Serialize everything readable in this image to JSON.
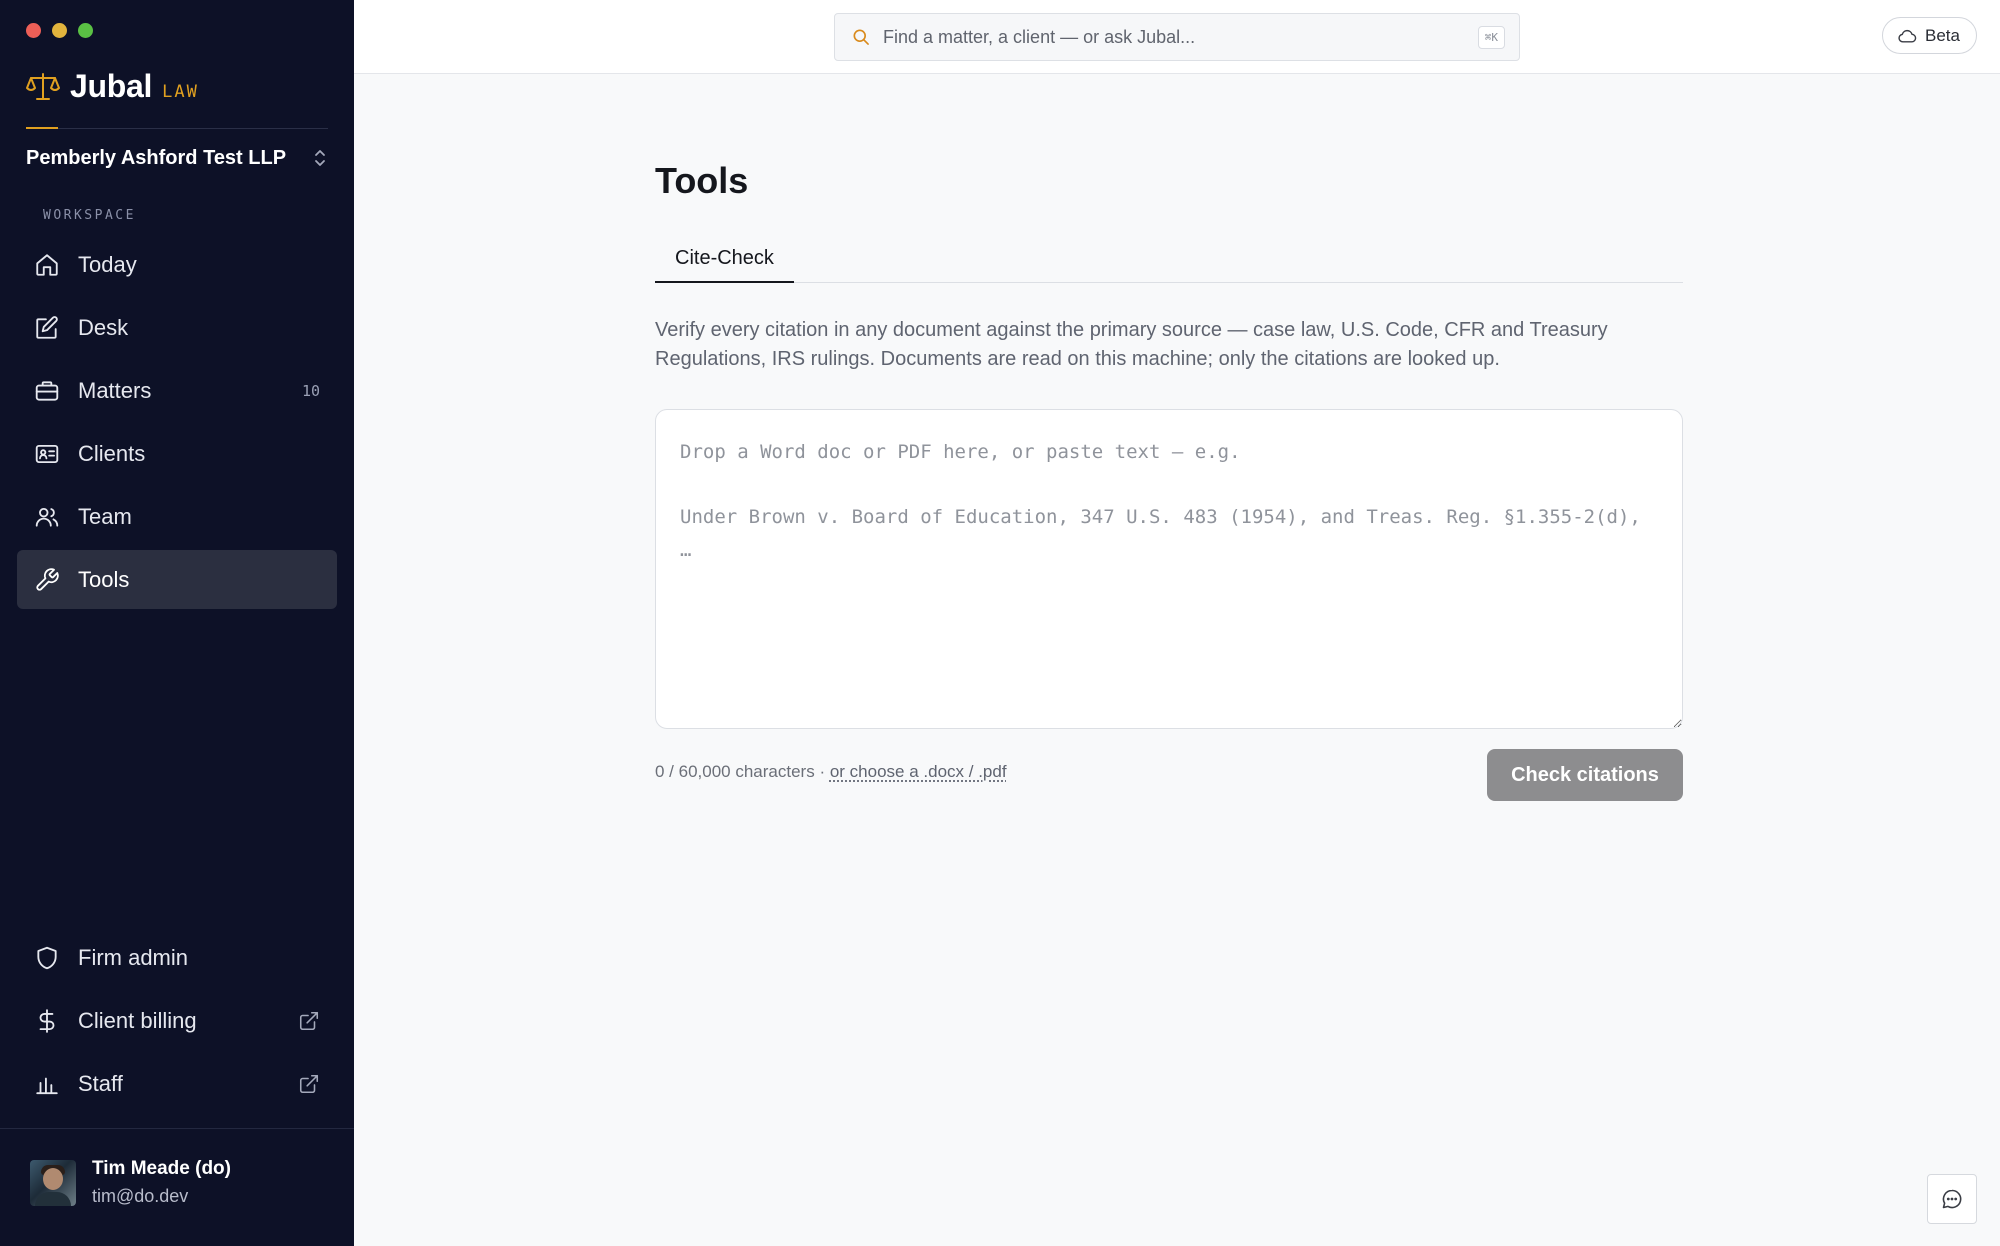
{
  "brand": {
    "name": "Jubal",
    "tag": "LAW",
    "accent": "#e0a020"
  },
  "firm": {
    "name": "Pemberly Ashford Test LLP"
  },
  "sidebar": {
    "section_label": "WORKSPACE",
    "items": [
      {
        "label": "Today",
        "icon": "home-icon"
      },
      {
        "label": "Desk",
        "icon": "edit-icon"
      },
      {
        "label": "Matters",
        "icon": "briefcase-icon",
        "count": "10"
      },
      {
        "label": "Clients",
        "icon": "id-card-icon"
      },
      {
        "label": "Team",
        "icon": "users-icon"
      },
      {
        "label": "Tools",
        "icon": "wrench-icon",
        "active": true
      }
    ],
    "bottom_items": [
      {
        "label": "Firm admin",
        "icon": "shield-icon"
      },
      {
        "label": "Client billing",
        "icon": "dollar-icon",
        "external": true
      },
      {
        "label": "Staff",
        "icon": "bar-chart-icon",
        "external": true
      }
    ]
  },
  "user": {
    "name": "Tim Meade (do)",
    "email": "tim@do.dev"
  },
  "search": {
    "placeholder": "Find a matter, a client — or ask Jubal...",
    "shortcut": "⌘K"
  },
  "beta_label": "Beta",
  "main": {
    "title": "Tools",
    "tabs": [
      {
        "label": "Cite-Check",
        "active": true
      }
    ],
    "description": "Verify every citation in any document against the primary source — case law, U.S. Code, CFR and Treasury Regulations, IRS rulings. Documents are read on this machine; only the citations are looked up.",
    "textarea_placeholder": "Drop a Word doc or PDF here, or paste text — e.g.\n\nUnder Brown v. Board of Education, 347 U.S. 483 (1954), and Treas. Reg. §1.355-2(d), …",
    "char_count": "0 / 60,000 characters",
    "separator": " · ",
    "choose_file_link": "or choose a .docx / .pdf",
    "check_button": "Check citations"
  }
}
